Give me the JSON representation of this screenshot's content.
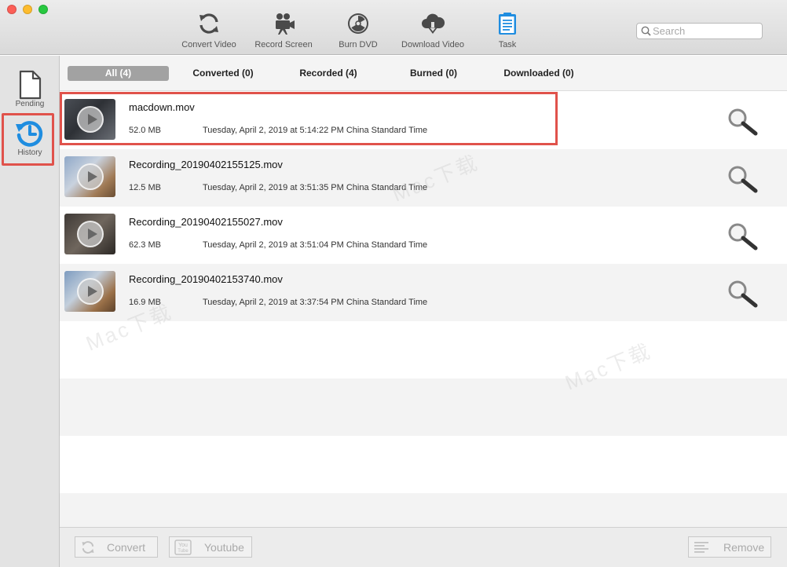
{
  "toolbar": {
    "items": [
      {
        "label": "Convert Video",
        "icon": "convert-icon"
      },
      {
        "label": "Record Screen",
        "icon": "video-camera-icon"
      },
      {
        "label": "Burn DVD",
        "icon": "radiation-icon"
      },
      {
        "label": "Download Video",
        "icon": "cloud-download-icon"
      },
      {
        "label": "Task",
        "icon": "clipboard-icon"
      }
    ],
    "search_placeholder": "Search"
  },
  "sidebar": {
    "items": [
      {
        "label": "Pending",
        "icon": "document-icon"
      },
      {
        "label": "History",
        "icon": "history-clock-icon"
      }
    ]
  },
  "tabs": [
    {
      "label": "All (4)",
      "active": true
    },
    {
      "label": "Converted (0)",
      "active": false
    },
    {
      "label": "Recorded (4)",
      "active": false
    },
    {
      "label": "Burned (0)",
      "active": false
    },
    {
      "label": "Downloaded (0)",
      "active": false
    }
  ],
  "files": [
    {
      "name": "macdown.mov",
      "size": "52.0 MB",
      "date": "Tuesday, April 2, 2019 at 5:14:22 PM China Standard Time"
    },
    {
      "name": "Recording_20190402155125.mov",
      "size": "12.5 MB",
      "date": "Tuesday, April 2, 2019 at 3:51:35 PM China Standard Time"
    },
    {
      "name": "Recording_20190402155027.mov",
      "size": "62.3 MB",
      "date": "Tuesday, April 2, 2019 at 3:51:04 PM China Standard Time"
    },
    {
      "name": "Recording_20190402153740.mov",
      "size": "16.9 MB",
      "date": "Tuesday, April 2, 2019 at 3:37:54 PM China Standard Time"
    }
  ],
  "bottom": {
    "convert_label": "Convert",
    "youtube_label": "Youtube",
    "remove_label": "Remove"
  },
  "colors": {
    "highlight": "#e0524b",
    "history_blue": "#1f8de0",
    "active_tab": "#a2a2a2"
  }
}
